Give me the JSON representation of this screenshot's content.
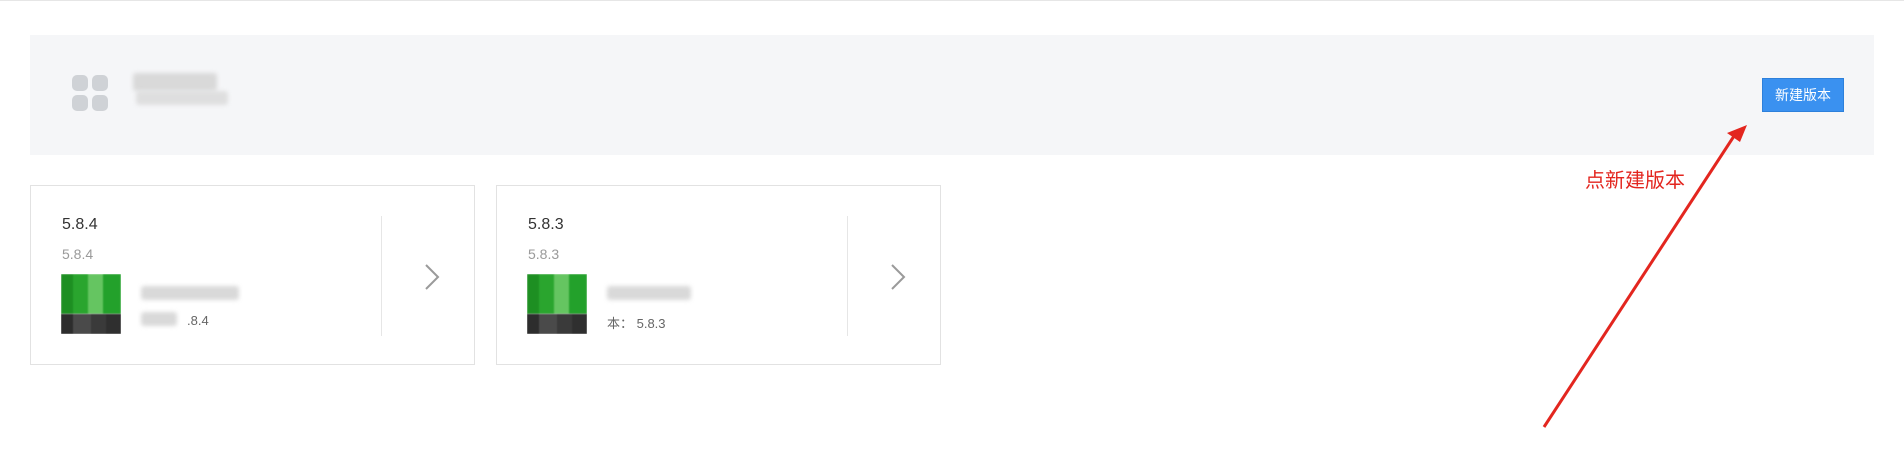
{
  "header": {
    "new_version_button": "新建版本"
  },
  "annotation": {
    "text": "点新建版本",
    "color": "#e3261f"
  },
  "versions": [
    {
      "title": "5.8.4",
      "subtitle": "5.8.4",
      "version_line": ".8.4"
    },
    {
      "title": "5.8.3",
      "subtitle": "5.8.3",
      "version_line": "本：   5.8.3"
    }
  ],
  "colors": {
    "button_blue": "#3a91f0",
    "header_background": "#f5f6f8"
  },
  "icons": {
    "app": "app-grid-icon",
    "card_arrow": "chevron-right-icon"
  }
}
